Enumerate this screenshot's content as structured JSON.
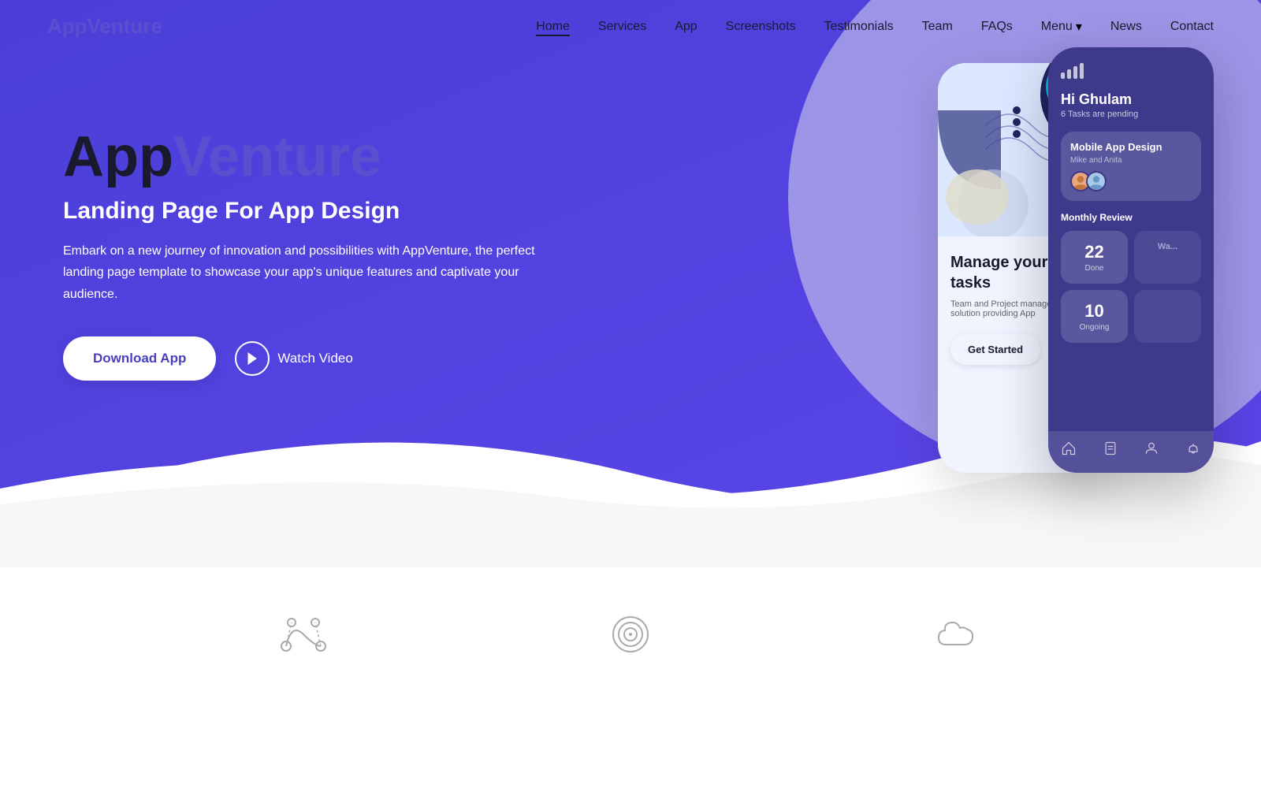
{
  "brand": {
    "name_dark": "App",
    "name_accent": "Venture"
  },
  "nav": {
    "links": [
      {
        "label": "Home",
        "active": true
      },
      {
        "label": "Services",
        "active": false
      },
      {
        "label": "App",
        "active": false
      },
      {
        "label": "Screenshots",
        "active": false
      },
      {
        "label": "Testimonials",
        "active": false
      },
      {
        "label": "Team",
        "active": false
      },
      {
        "label": "FAQs",
        "active": false
      },
      {
        "label": "Menu",
        "has_dropdown": true,
        "active": false
      },
      {
        "label": "News",
        "active": false
      },
      {
        "label": "Contact",
        "active": false
      }
    ]
  },
  "hero": {
    "title_dark": "App",
    "title_accent": "Venture",
    "subtitle": "Landing Page For App Design",
    "description": "Embark on a new journey of innovation and possibilities with AppVenture, the perfect landing page template to showcase your app's unique features and captivate your audience.",
    "cta_primary": "Download App",
    "cta_secondary": "Watch Video"
  },
  "phone_front": {
    "greeting": "Hi Ghulam",
    "tasks_pending": "6 Tasks are pending",
    "project_title": "Mobile App Design",
    "project_members": "Mike and Anita",
    "monthly_review": "Monthly Review",
    "stat_done_number": "22",
    "stat_done_label": "Done",
    "stat_ongoing_number": "10",
    "stat_ongoing_label": "Ongoing"
  },
  "phone_back": {
    "title": "Manage your daily tasks",
    "description": "Team and Project management with solution providing App",
    "cta": "Get Started"
  },
  "bottom_icons": [
    {
      "name": "bezier-icon",
      "label": ""
    },
    {
      "name": "target-icon",
      "label": ""
    },
    {
      "name": "cloud-icon",
      "label": ""
    }
  ]
}
